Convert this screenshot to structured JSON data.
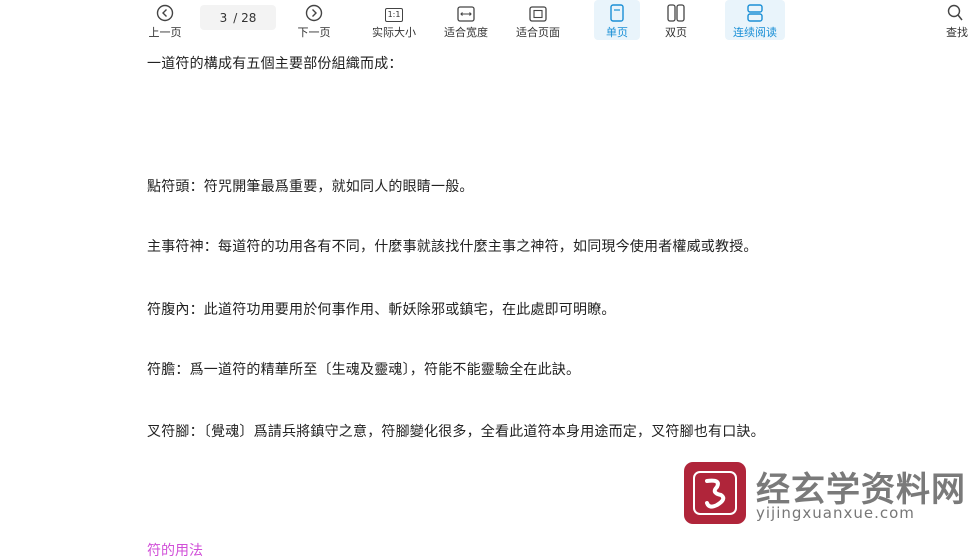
{
  "toolbar": {
    "prev_page": "上一页",
    "next_page": "下一页",
    "current_page": "3",
    "total_pages": "/ 28",
    "actual_size": "实际大小",
    "actual_size_icon_text": "1:1",
    "fit_width": "适合宽度",
    "fit_page": "适合页面",
    "single_page": "单页",
    "double_page": "双页",
    "continuous": "连续阅读",
    "search": "查找",
    "accent_color": "#1a8fd6"
  },
  "document": {
    "intro": "一道符的構成有五個主要部份組織而成：",
    "lines": [
      "點符頭：符咒開筆最爲重要，就如同人的眼睛一般。",
      "主事符神：每道符的功用各有不同，什麼事就該找什麼主事之神符，如同現今使用者權威或教授。",
      "符腹內：此道符功用要用於何事作用、斬妖除邪或鎮宅，在此處即可明瞭。",
      "符膽：爲一道符的精華所至〔生魂及靈魂〕，符能不能靈驗全在此訣。",
      "叉符腳：〔覺魂〕爲請兵將鎮守之意，符腳變化很多，全看此道符本身用途而定，叉符腳也有口訣。"
    ],
    "next_heading": "符的用法",
    "heading_color": "#d14fd8"
  },
  "watermark": {
    "title": "经玄学资料网",
    "url": "yijingxuanxue.com"
  }
}
